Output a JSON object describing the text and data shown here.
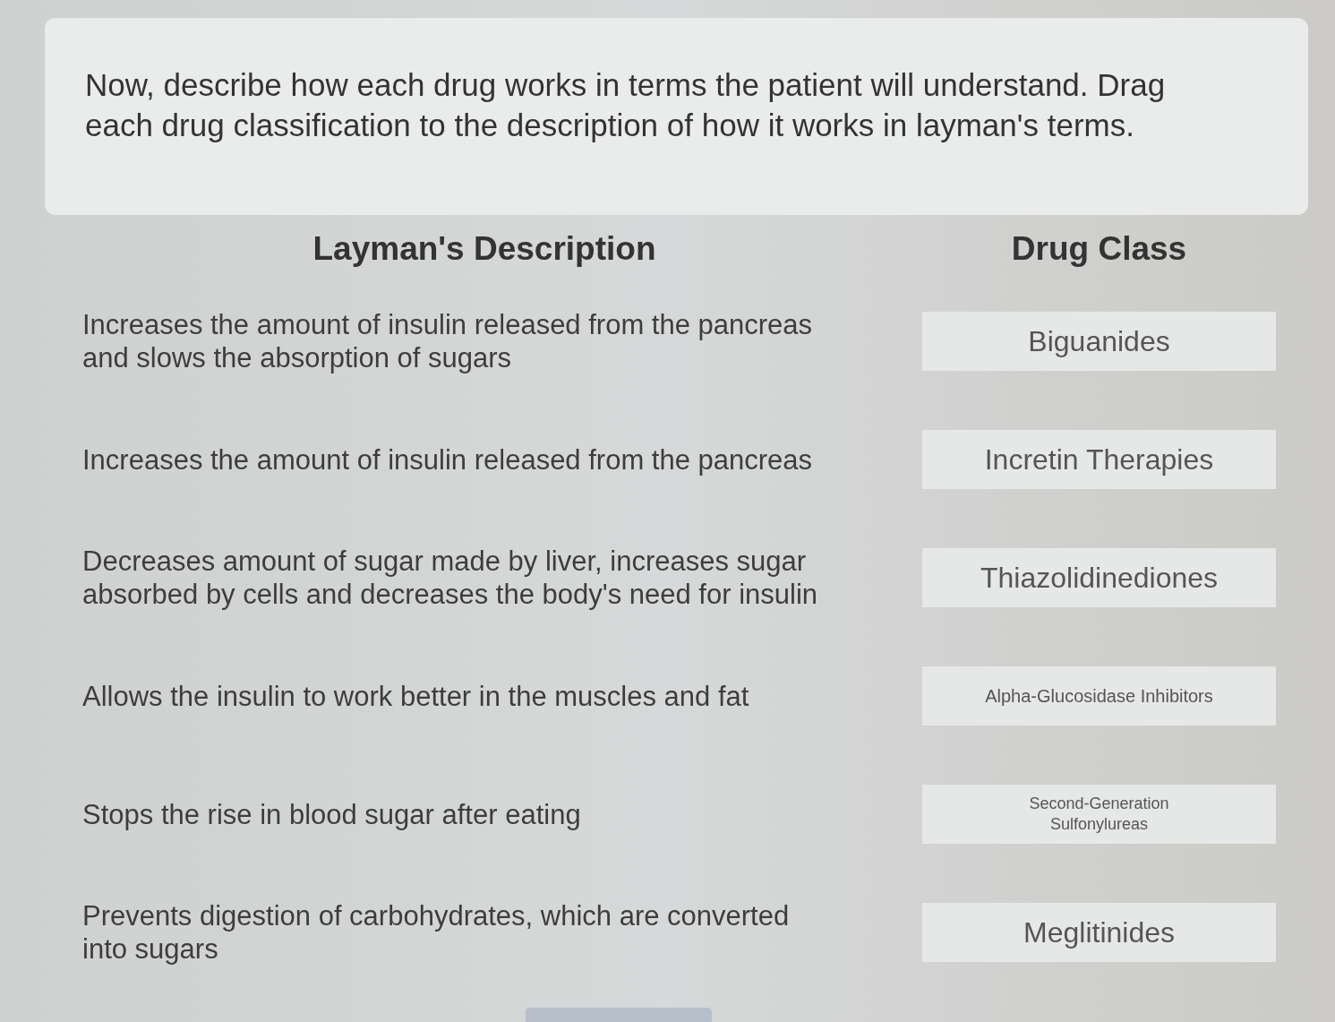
{
  "instructions": "Now, describe how each drug works in terms the patient will understand. Drag each drug classification to the description of how it works in layman's terms.",
  "headings": {
    "description": "Layman's Description",
    "drug_class": "Drug Class"
  },
  "descriptions": [
    "Increases the amount of insulin released from the pancreas and slows the absorption of sugars",
    "Increases the amount of insulin released from the pancreas",
    "Decreases amount of sugar made by liver, increases sugar absorbed by cells and decreases the body's need for insulin",
    "Allows the insulin to work better in the muscles and fat",
    "Stops the rise in blood sugar after eating",
    "Prevents digestion of carbohydrates, which are converted into sugars"
  ],
  "drug_classes": [
    "Biguanides",
    "Incretin Therapies",
    "Thiazolidinediones",
    "Alpha-Glucosidase Inhibitors",
    "Second-Generation Sulfonylureas",
    "Meglitinides"
  ]
}
